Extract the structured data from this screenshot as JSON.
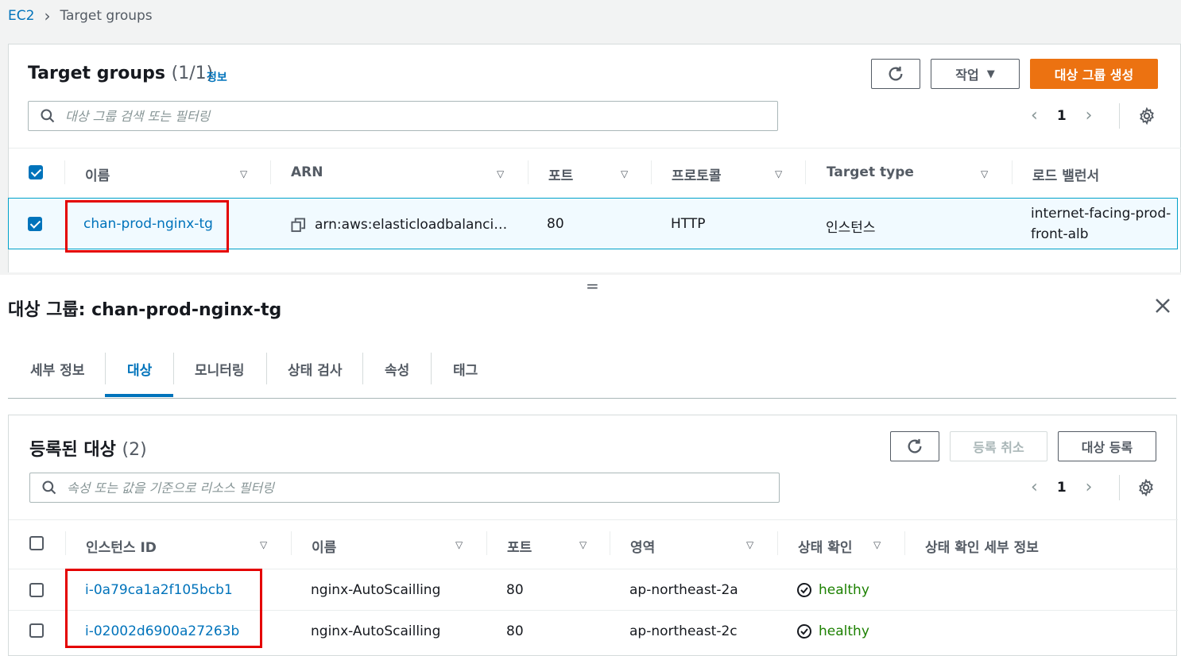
{
  "breadcrumb": {
    "root": "EC2",
    "current": "Target groups"
  },
  "list": {
    "title": "Target groups",
    "count": "(1/1)",
    "info_label": "정보",
    "actions_label": "작업",
    "create_label": "대상 그룹 생성",
    "search_placeholder": "대상 그룹 검색 또는 필터링",
    "page": "1",
    "columns": [
      "이름",
      "ARN",
      "포트",
      "프로토콜",
      "Target type",
      "로드 밸런서"
    ],
    "row": {
      "name": "chan-prod-nginx-tg",
      "arn": "arn:aws:elasticloadbalanci…",
      "port": "80",
      "protocol": "HTTP",
      "target_type": "인스턴스",
      "lb_line1": "internet-facing-prod-",
      "lb_line2": "front-alb"
    }
  },
  "detail": {
    "title": "대상 그룹: chan-prod-nginx-tg",
    "tabs": [
      "세부 정보",
      "대상",
      "모니터링",
      "상태 검사",
      "속성",
      "태그"
    ],
    "active_tab": "대상",
    "targets_title": "등록된 대상",
    "targets_count": "(2)",
    "deregister_label": "등록 취소",
    "register_label": "대상 등록",
    "search_placeholder": "속성 또는 값을 기준으로 리소스 필터링",
    "page": "1",
    "columns": [
      "인스턴스 ID",
      "이름",
      "포트",
      "영역",
      "상태 확인",
      "상태 확인 세부 정보"
    ],
    "rows": [
      {
        "id": "i-0a79ca1a2f105bcb1",
        "name": "nginx-AutoScailling",
        "port": "80",
        "zone": "ap-northeast-2a",
        "status": "healthy"
      },
      {
        "id": "i-02002d6900a27263b",
        "name": "nginx-AutoScailling",
        "port": "80",
        "zone": "ap-northeast-2c",
        "status": "healthy"
      }
    ]
  },
  "colors": {
    "link": "#0073bb",
    "primary": "#ec7211",
    "healthy": "#1d8102",
    "highlight": "#e40000"
  }
}
